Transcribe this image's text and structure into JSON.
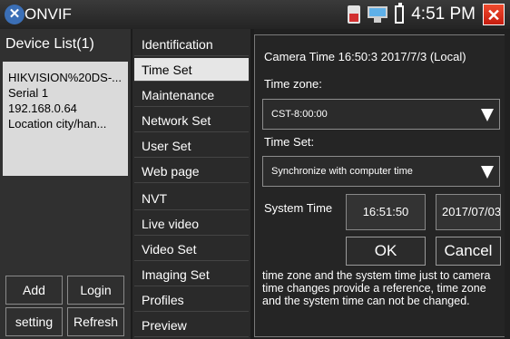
{
  "window": {
    "title": "ONVIF",
    "clock": "4:51 PM"
  },
  "devices": {
    "header": "Device List(1)",
    "card": [
      "HIKVISION%20DS-...",
      "Serial 1",
      "192.168.0.64",
      "Location city/han..."
    ],
    "buttons": {
      "add": "Add",
      "login": "Login",
      "setting": "setting",
      "refresh": "Refresh"
    }
  },
  "menu": {
    "items": [
      "Identification",
      "Time Set",
      "Maintenance",
      "Network Set",
      "User Set",
      "Web page",
      "NVT",
      "Live video",
      "Video Set",
      "Imaging Set",
      "Profiles",
      "Preview"
    ],
    "selected": "Time Set"
  },
  "timeset": {
    "camera_time": "Camera Time 16:50:3  2017/7/3 (Local)",
    "time_zone_label": "Time zone:",
    "time_zone_value": "CST-8:00:00",
    "time_set_label": "Time Set:",
    "time_set_value": "Synchronize with computer time",
    "system_time_label": "System Time",
    "system_time": "16:51:50",
    "system_date": "2017/07/03",
    "ok": "OK",
    "cancel": "Cancel",
    "note": "time zone and the system time just to camera time changes provide a reference, time zone and the system time can not be changed."
  }
}
